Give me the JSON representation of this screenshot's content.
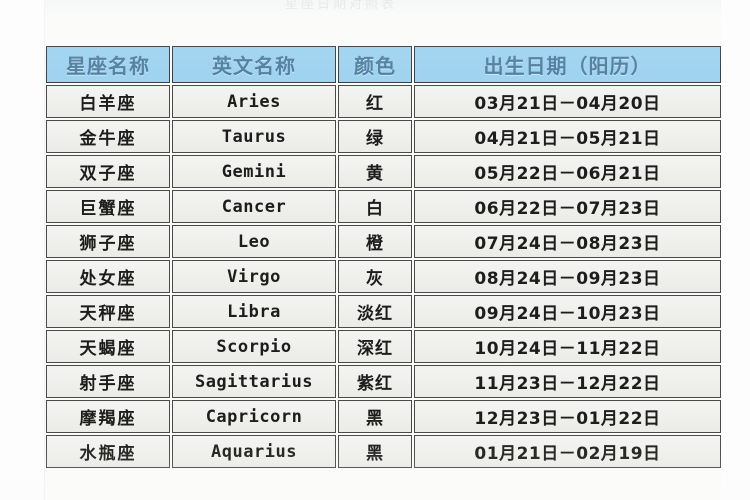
{
  "page": {
    "top_strip_ghost_text": "星座日期对照表"
  },
  "colors": {
    "header_background": "#9ed2ef",
    "header_text": "#4f7ea0",
    "cell_background": "#f0f0ee",
    "cell_text": "#1d1d1d",
    "border": "#4a4a4a",
    "page_background": "#fbfbfa"
  },
  "table": {
    "columns": [
      {
        "key": "name",
        "label": "星座名称"
      },
      {
        "key": "eng",
        "label": "英文名称"
      },
      {
        "key": "color",
        "label": "颜色"
      },
      {
        "key": "date",
        "label": "出生日期（阳历）"
      }
    ],
    "rows": [
      {
        "name": "白羊座",
        "eng": "Aries",
        "color": "红",
        "date": "03月21日－04月20日"
      },
      {
        "name": "金牛座",
        "eng": "Taurus",
        "color": "绿",
        "date": "04月21日－05月21日"
      },
      {
        "name": "双子座",
        "eng": "Gemini",
        "color": "黄",
        "date": "05月22日－06月21日"
      },
      {
        "name": "巨蟹座",
        "eng": "Cancer",
        "color": "白",
        "date": "06月22日－07月23日"
      },
      {
        "name": "狮子座",
        "eng": "Leo",
        "color": "橙",
        "date": "07月24日－08月23日"
      },
      {
        "name": "处女座",
        "eng": "Virgo",
        "color": "灰",
        "date": "08月24日－09月23日"
      },
      {
        "name": "天秤座",
        "eng": "Libra",
        "color": "淡红",
        "date": "09月24日－10月23日"
      },
      {
        "name": "天蝎座",
        "eng": "Scorpio",
        "color": "深红",
        "date": "10月24日－11月22日"
      },
      {
        "name": "射手座",
        "eng": "Sagittarius",
        "color": "紫红",
        "date": "11月23日－12月22日"
      },
      {
        "name": "摩羯座",
        "eng": "Capricorn",
        "color": "黑",
        "date": "12月23日－01月22日"
      },
      {
        "name": "水瓶座",
        "eng": "Aquarius",
        "color": "黑",
        "date": "01月21日－02月19日"
      }
    ]
  }
}
